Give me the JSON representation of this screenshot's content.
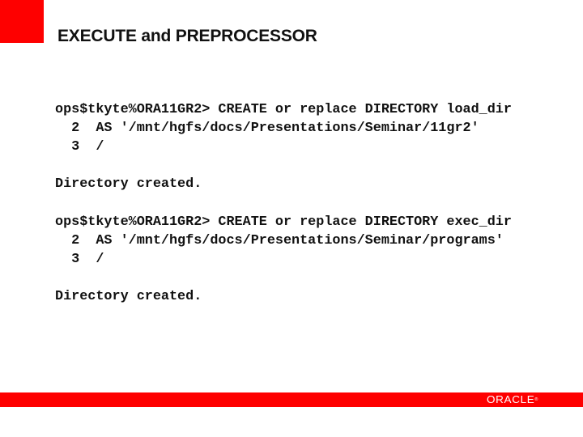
{
  "slide": {
    "title": "EXECUTE and PREPROCESSOR",
    "brand_color": "#fe0000",
    "code_lines": [
      "ops$tkyte%ORA11GR2> CREATE or replace DIRECTORY load_dir",
      "  2  AS '/mnt/hgfs/docs/Presentations/Seminar/11gr2'",
      "  3  /",
      "",
      "Directory created.",
      "",
      "ops$tkyte%ORA11GR2> CREATE or replace DIRECTORY exec_dir",
      "  2  AS '/mnt/hgfs/docs/Presentations/Seminar/programs'",
      "  3  /",
      "",
      "Directory created."
    ]
  },
  "footer": {
    "logo_text": "ORACLE",
    "logo_mark": "®"
  }
}
